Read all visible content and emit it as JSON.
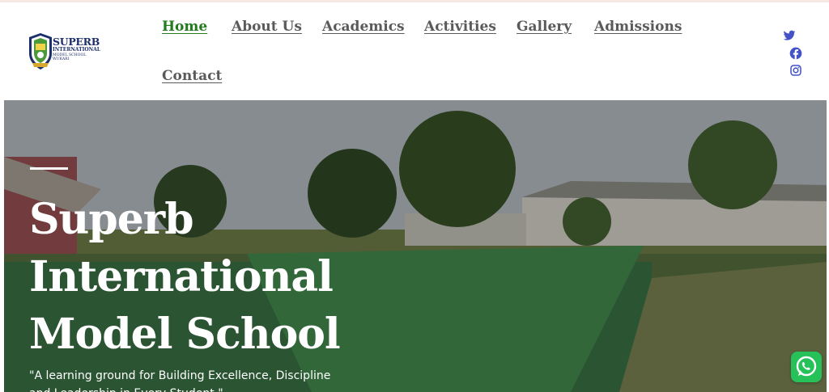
{
  "brand": {
    "name": "SUPERB",
    "line2": "INTERNATIONAL",
    "line3": "MODEL SCHOOL",
    "line4": "WUKARI"
  },
  "nav": {
    "items": [
      {
        "label": "Home",
        "active": true
      },
      {
        "label": "About Us"
      },
      {
        "label": "Academics"
      },
      {
        "label": "Activities"
      },
      {
        "label": "Gallery"
      },
      {
        "label": "Admissions"
      },
      {
        "label": "Contact"
      }
    ]
  },
  "social": {
    "icons": [
      "twitter-icon",
      "facebook-icon",
      "instagram-icon"
    ],
    "color": "#4353c7"
  },
  "hero": {
    "title": "Superb International Model School",
    "quote": "\"A learning ground for Building Excellence, Discipline and Leadership in Every Student.\""
  },
  "colors": {
    "nav_active": "#237a1c",
    "nav_text": "#5a5a5a",
    "whatsapp": "#27c15a",
    "brand_navy": "#1c2f6b"
  }
}
